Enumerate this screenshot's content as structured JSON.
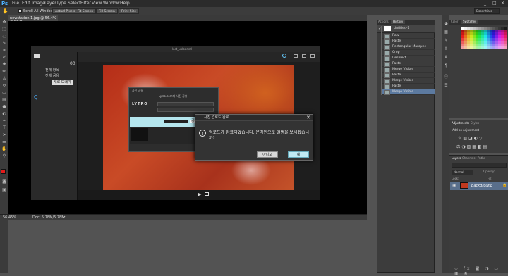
{
  "menubar": {
    "logo": "Ps",
    "items": [
      "File",
      "Edit",
      "Image",
      "Layer",
      "Type",
      "Select",
      "Filter",
      "View",
      "Window",
      "Help"
    ],
    "controls": [
      "_",
      "□",
      "✕"
    ]
  },
  "options": {
    "scroll_all": "Scroll All Windows",
    "actual_pixels": "Actual Pixels",
    "fit_screen": "Fit Screen",
    "fill_screen": "Fill Screen",
    "print_size": "Print Size",
    "workspace": "Essentials"
  },
  "document": {
    "tab_title": "newstation 1.jpg @ 56.4% (RGB/8)",
    "zoom": "56.45%",
    "doc_size": "Doc: 5.78M/5.78M"
  },
  "screenshot_app": {
    "top_label": "last_uploaded",
    "side_label_1": "전체 항목",
    "side_label_2": "전체 공유",
    "side_plus": "+00",
    "side_button": "새로 보내기",
    "lytro_title": "사진 공유",
    "lytro_header": "Lytro.com에 사진 공유",
    "lytro_logo": "LYTRO",
    "lytro_field": "",
    "lytro_share": "공유 중"
  },
  "dialog": {
    "title": "사진 업로드 완료",
    "message": "업로드가 완료되었습니다. 온라인으로 앨범을 보시겠습니까?",
    "no_label": "아니오",
    "yes_label": "예"
  },
  "panels": {
    "history_tabs": [
      "Actions",
      "History"
    ],
    "snapshot": "Untitled-1",
    "history_items": [
      "Raw",
      "Paste",
      "Rectangular Marquee",
      "Crop",
      "Deselect",
      "Paste",
      "Merge Visible",
      "Paste",
      "Merge Visible",
      "Paste",
      "Merge Visible"
    ],
    "color_tabs": [
      "Color",
      "Swatches"
    ],
    "adjust_tabs": [
      "Adjustments",
      "Styles"
    ],
    "adjust_label": "Add an adjustment",
    "layers_tabs": [
      "Layers",
      "Channels",
      "Paths"
    ],
    "blend_mode": "Normal",
    "opacity_label": "Opacity:",
    "lock_label": "Lock:",
    "fill_label": "Fill:",
    "layer_name": "Background"
  },
  "colors": {
    "ps_blue": "#4db0ff",
    "dialog_yes": "#bfe9f3",
    "selected_history": "#5c7aa0",
    "photo_red": "#c0391f"
  }
}
